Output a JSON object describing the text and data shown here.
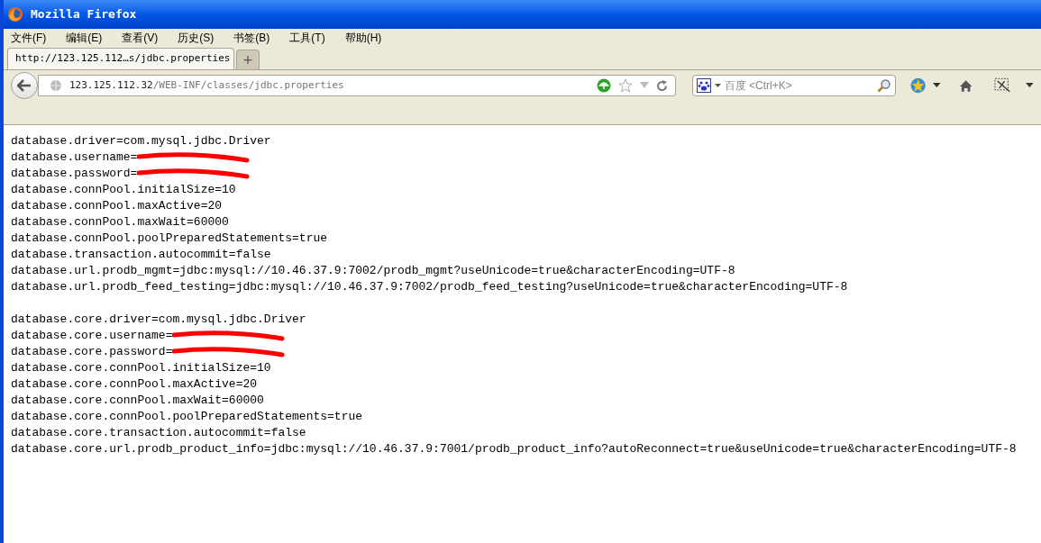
{
  "window": {
    "title": "Mozilla Firefox"
  },
  "menu": [
    "文件(F)",
    "编辑(E)",
    "查看(V)",
    "历史(S)",
    "书签(B)",
    "工具(T)",
    "帮助(H)"
  ],
  "tabs": [
    {
      "label": "http://123.125.112…s/jdbc.properties",
      "selected": true
    }
  ],
  "new_tab_button": "+",
  "address_bar": {
    "host": "123.125.112.32",
    "path": "/WEB-INF/classes/jdbc.properties"
  },
  "search": {
    "placeholder": "百度 <Ctrl+K>"
  },
  "content": {
    "sections": [
      {
        "lines": [
          {
            "text": "database.driver=com.mysql.jdbc.Driver",
            "redacted": false
          },
          {
            "text": "database.username=",
            "redacted": true
          },
          {
            "text": "database.password=",
            "redacted": true
          },
          {
            "text": "database.connPool.initialSize=10",
            "redacted": false
          },
          {
            "text": "database.connPool.maxActive=20",
            "redacted": false
          },
          {
            "text": "database.connPool.maxWait=60000",
            "redacted": false
          },
          {
            "text": "database.connPool.poolPreparedStatements=true",
            "redacted": false
          },
          {
            "text": "database.transaction.autocommit=false",
            "redacted": false
          },
          {
            "text": "database.url.prodb_mgmt=jdbc:mysql://10.46.37.9:7002/prodb_mgmt?useUnicode=true&characterEncoding=UTF-8",
            "redacted": false
          },
          {
            "text": "database.url.prodb_feed_testing=jdbc:mysql://10.46.37.9:7002/prodb_feed_testing?useUnicode=true&characterEncoding=UTF-8",
            "redacted": false
          }
        ]
      },
      {
        "lines": [
          {
            "text": "database.core.driver=com.mysql.jdbc.Driver",
            "redacted": false
          },
          {
            "text": "database.core.username=",
            "redacted": true
          },
          {
            "text": "database.core.password=",
            "redacted": true
          },
          {
            "text": "database.core.connPool.initialSize=10",
            "redacted": false
          },
          {
            "text": "database.core.connPool.maxActive=20",
            "redacted": false
          },
          {
            "text": "database.core.connPool.maxWait=60000",
            "redacted": false
          },
          {
            "text": "database.core.connPool.poolPreparedStatements=true",
            "redacted": false
          },
          {
            "text": "database.core.transaction.autocommit=false",
            "redacted": false
          },
          {
            "text": "database.core.url.prodb_product_info=jdbc:mysql://10.46.37.9:7001/prodb_product_info?autoReconnect=true&useUnicode=true&characterEncoding=UTF-8",
            "redacted": false
          }
        ]
      }
    ]
  }
}
